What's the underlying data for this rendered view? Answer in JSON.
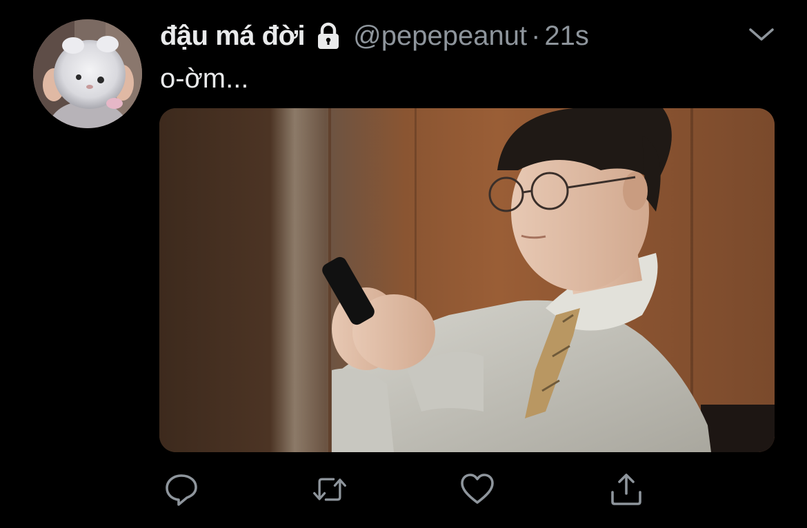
{
  "tweet": {
    "display_name": "đậu má đời",
    "handle": "@pepepeanut",
    "separator": "·",
    "time": "21s",
    "text": "o-ờm..."
  },
  "icons": {
    "lock": "lock-icon",
    "menu": "chevron-down-icon",
    "reply": "reply-icon",
    "retweet": "retweet-icon",
    "like": "heart-icon",
    "share": "share-icon"
  },
  "colors": {
    "background": "#000000",
    "primary_text": "#e9eaeb",
    "secondary_text": "#8e959c",
    "icon": "#8e959c"
  }
}
